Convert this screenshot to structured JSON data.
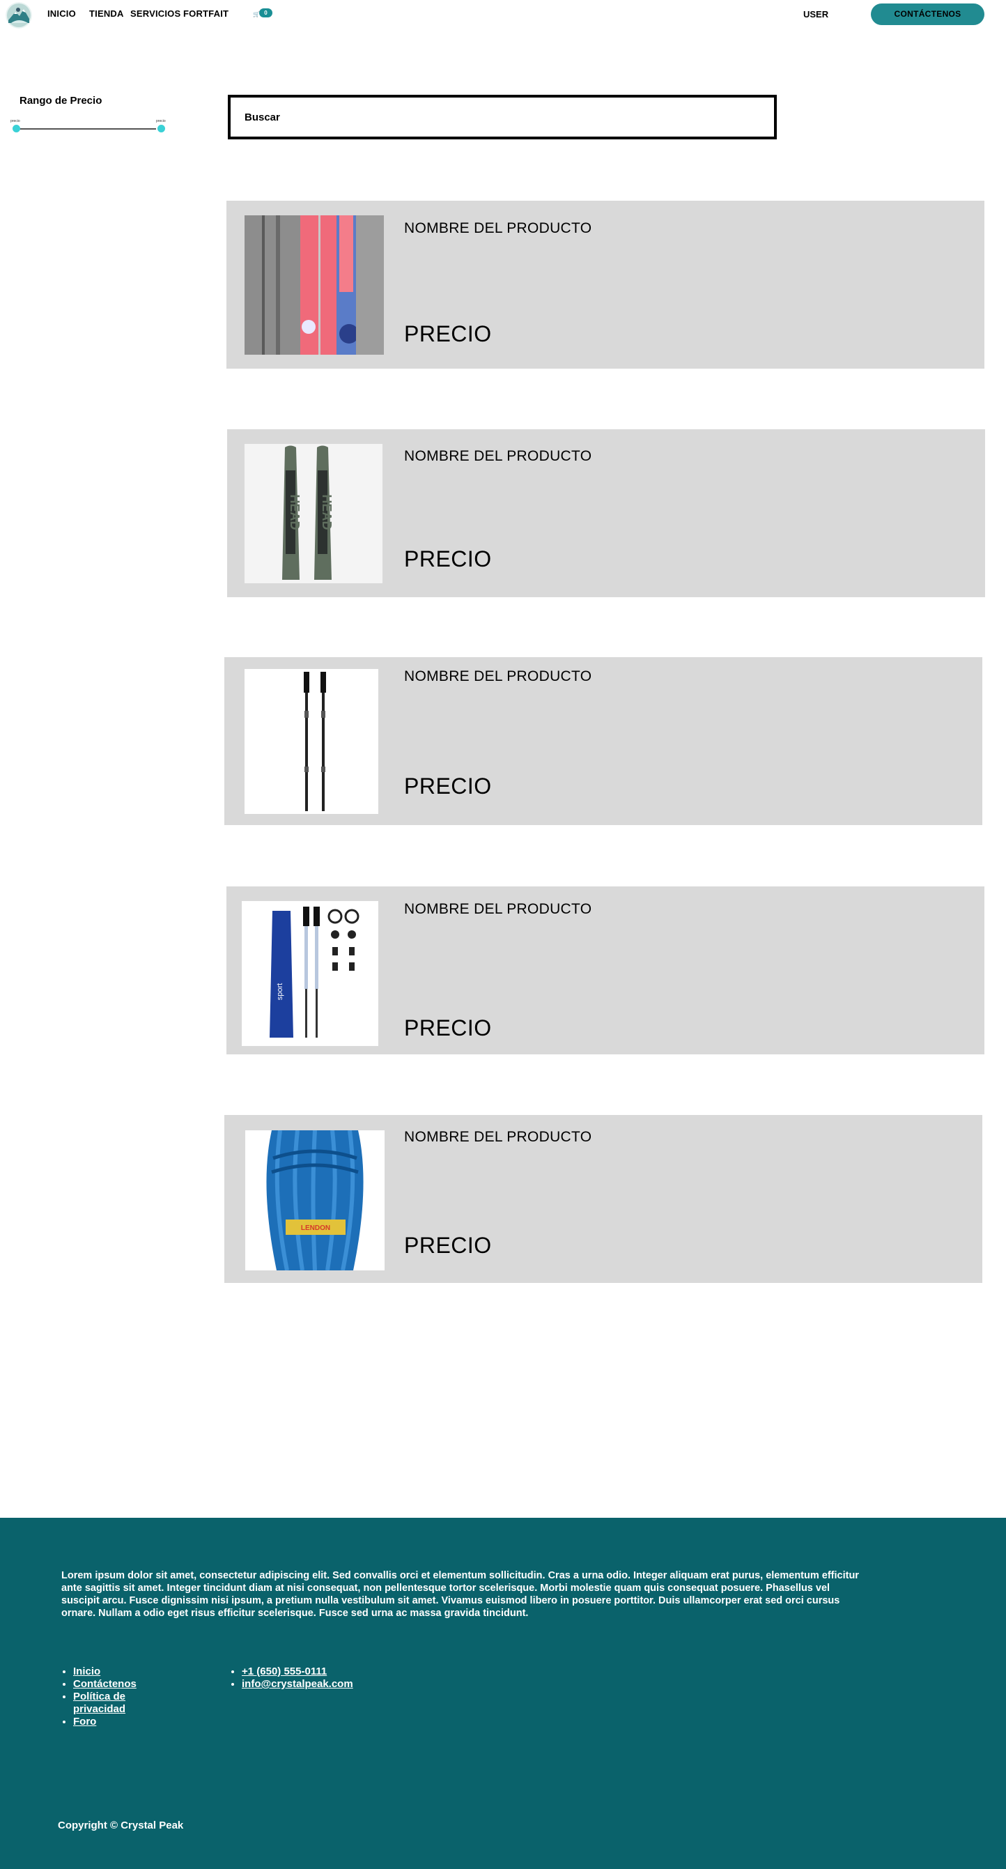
{
  "header": {
    "nav": [
      {
        "label": "INICIO"
      },
      {
        "label": "TIENDA"
      },
      {
        "label": "SERVICIOS"
      },
      {
        "label": "FORTFAIT"
      }
    ],
    "cart_icon_text": "🛒",
    "cart_count": "0",
    "user_label": "USER",
    "contact_label": "CONTÁCTENOS"
  },
  "filter": {
    "title": "Rango de Precio",
    "min_label": "precio",
    "max_label": "precio"
  },
  "search": {
    "label": "Buscar"
  },
  "products": [
    {
      "name": "NOMBRE DEL PRODUCTO",
      "price": "PRECIO",
      "image": "skis-pink-icon"
    },
    {
      "name": "NOMBRE DEL PRODUCTO",
      "price": "PRECIO",
      "image": "skis-head-icon"
    },
    {
      "name": "NOMBRE DEL PRODUCTO",
      "price": "PRECIO",
      "image": "ski-poles-icon"
    },
    {
      "name": "NOMBRE DEL PRODUCTO",
      "price": "PRECIO",
      "image": "trekking-poles-kit-icon"
    },
    {
      "name": "NOMBRE DEL PRODUCTO",
      "price": "PRECIO",
      "image": "climbing-rope-icon"
    }
  ],
  "footer": {
    "text": "Lorem ipsum dolor sit amet, consectetur adipiscing elit. Sed convallis orci et elementum sollicitudin. Cras a urna odio. Integer aliquam erat purus, elementum efficitur ante sagittis sit amet. Integer tincidunt diam at nisi consequat, non pellentesque tortor scelerisque. Morbi molestie quam quis consequat posuere. Phasellus vel suscipit arcu. Fusce dignissim nisi ipsum, a pretium nulla vestibulum sit amet. Vivamus euismod libero in posuere porttitor. Duis ullamcorper erat sed orci cursus ornare. Nullam a odio eget risus efficitur scelerisque. Fusce sed urna ac massa gravida tincidunt.",
    "links": [
      "Inicio",
      "Contáctenos",
      "Política de privacidad",
      "Foro"
    ],
    "contacts": [
      "+1 (650) 555-0111",
      "info@crystalpeak.com"
    ],
    "copyright": "Copyright © Crystal Peak"
  },
  "colors": {
    "accent": "#218b91",
    "footer_bg": "#0a626b",
    "card_bg": "#d9d9d9",
    "slider_thumb": "#3ad1d6"
  }
}
